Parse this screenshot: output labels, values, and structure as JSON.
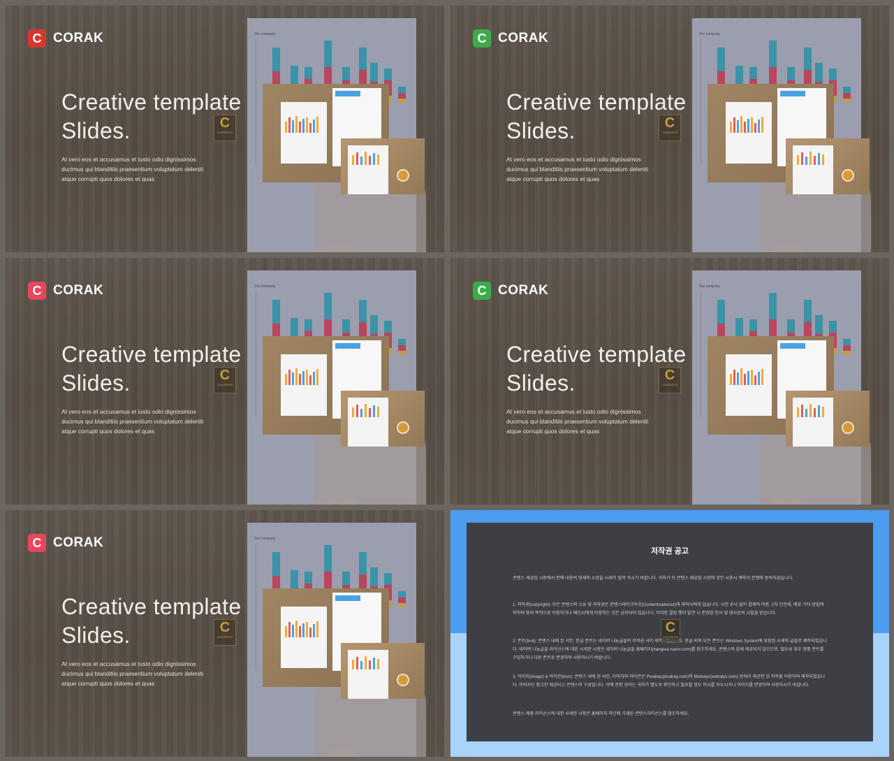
{
  "slides": [
    {
      "brand": "CORAK",
      "logo_letter": "C",
      "logo_color": "#d3382f",
      "title_line1": "Creative template",
      "title_line2": "Slides.",
      "body_line1": "At vero eos et accusamus et iusto odio dignissimos",
      "body_line2": "ducimus qui blanditiis praesentium voluptatum deleniti",
      "body_line3": "atque corrupti quos dolores et quas"
    },
    {
      "brand": "CORAK",
      "logo_letter": "C",
      "logo_color": "#3dab4c",
      "title_line1": "Creative template",
      "title_line2": "Slides.",
      "body_line1": "At vero eos et accusamus et iusto odio dignissimos",
      "body_line2": "ducimus qui blanditiis praesentium voluptatum deleniti",
      "body_line3": "atque corrupti quos dolores et quas"
    },
    {
      "brand": "CORAK",
      "logo_letter": "C",
      "logo_color": "#e8465c",
      "title_line1": "Creative template",
      "title_line2": "Slides.",
      "body_line1": "At vero eos et accusamus et iusto odio dignissimos",
      "body_line2": "ducimus qui blanditiis praesentium voluptatum deleniti",
      "body_line3": "atque corrupti quos dolores et quas"
    },
    {
      "brand": "CORAK",
      "logo_letter": "C",
      "logo_color": "#3dab4c",
      "title_line1": "Creative template",
      "title_line2": "Slides.",
      "body_line1": "At vero eos et accusamus et iusto odio dignissimos",
      "body_line2": "ducimus qui blanditiis praesentium voluptatum deleniti",
      "body_line3": "atque corrupti quos dolores et quas"
    },
    {
      "brand": "CORAK",
      "logo_letter": "C",
      "logo_color": "#e8465c",
      "title_line1": "Creative template",
      "title_line2": "Slides.",
      "body_line1": "At vero eos et accusamus et iusto odio dignissimos",
      "body_line2": "ducimus qui blanditiis praesentium voluptatum deleniti",
      "body_line3": "atque corrupti quos dolores et quas"
    }
  ],
  "paper": {
    "title": "Our company"
  },
  "watermark": {
    "letter": "C",
    "text": "CONTENTS"
  },
  "notice": {
    "title": "저작권 공고",
    "p1": "콘텐스 제공업 시장에서 판매 내용의 현재와 소망을 시세이 필여 주시기 바랍니다. 귀하가 이 콘텐스 제공업 시장에 것인 시용시 계약서 분쟁에 동의하셨습니다.",
    "p2": "1. 저작권(copyright): 모든 콘텐스의 소유 및 저작권은 콘텐스테이크아웃(Contentstakeout)에 제작사에게 있습니다. 시전 승낙 없이 결제적 이용, 2차 단전세, 배포 기타 방법에 의하여 영리 목적으로 이용하거나 배신시에게 이용하는 것은 금지되어 있습니다. 이러한 결법 행위 발견 시 준엄한 민사 및 형사상의 시벌을 받습니다.",
    "p3": "2. 폰트(font): 콘텐스 내에 된 서인, 한글 폰트는 네이버 나눔글꼴의 저작권 사이 세작되었습니다. 한글 외의 모든 폰트는 Windows System에 포함된 시세의 글꼴로 제작되었습니다. 네이버 나눔글꼴 라이선스에 대한 시세한 시항은 네이버 나눔글꼴 홈페이지(hangeul.naver.com)를 참조하세요. 콘텐스와 함께 제공되지 않으므로, 필요성 경우 정품 폰트를 구입하거나 다른 폰트로 변경하여 사용하시기 바랍니다.",
    "p4": "3. 이미지(image) & 아이콘(icon): 콘텐스 내에 된 서인, 이미지와 아이콘은 Pixabay(pixabay.com)와 Webalys(webalys.com) 등에서 제공한 것 저작물 이용하여 제작되었습니다. 이미지는 참고만 제공되고 콘텐스의 구성입니다. 이에 관한 권리는 귀하가 별도로 확인하고 필요할 경우 이시를 쉬우시거나 이미지를 변경하여 사용하시기 바랍니다.",
    "p5": "콘텐스 제품 라이선스에 대한 시세한 시항은 홈페이지 하단에 기재된 콘텐스라이선스를 참조하세요."
  },
  "colors": {
    "wood": "#5a5149",
    "notice_blue": "#4c9cf0",
    "notice_light": "#a9d4fa",
    "notice_panel": "#3d3f45"
  },
  "icons": {
    "logo": "c-logo-icon",
    "watermark": "contents-watermark-icon"
  }
}
